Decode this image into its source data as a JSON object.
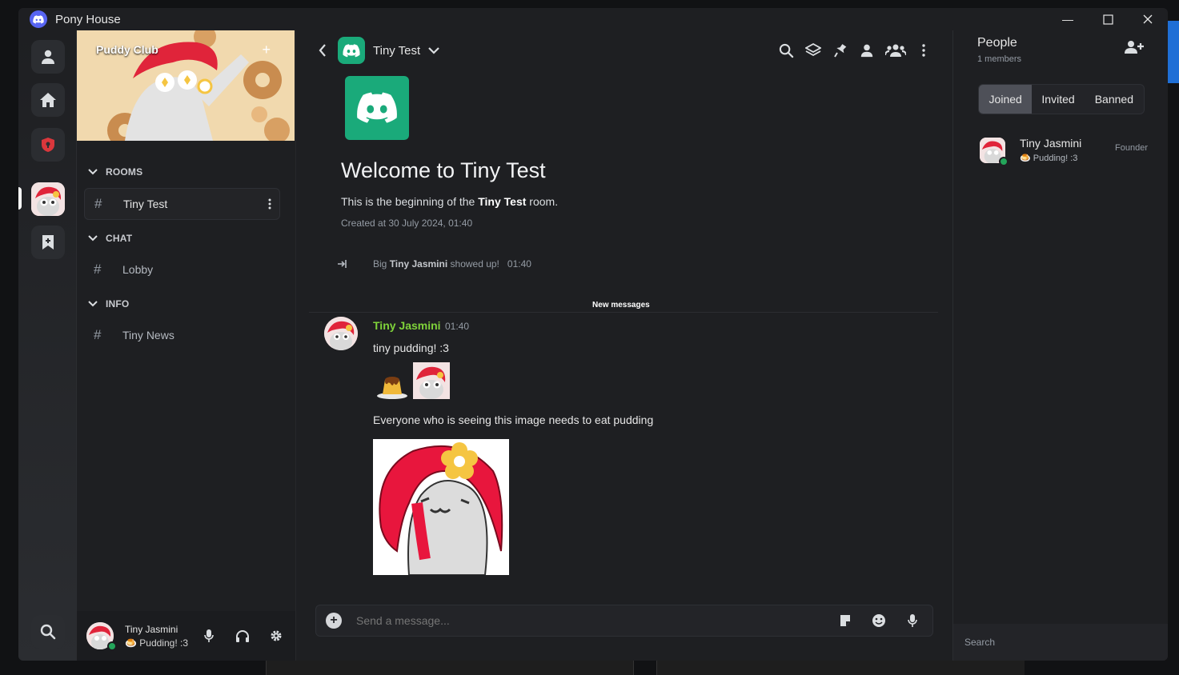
{
  "window": {
    "title": "Pony House"
  },
  "rail": {
    "items": [
      "profile-icon",
      "home-icon",
      "shield-icon",
      "puddy-club-avatar",
      "bookmark-icon"
    ],
    "search_icon": "search-icon"
  },
  "server": {
    "name": "Puddy Club",
    "add_icon": "+"
  },
  "categories": [
    {
      "label": "ROOMS",
      "rooms": [
        {
          "label": "Tiny Test",
          "active": true
        }
      ]
    },
    {
      "label": "CHAT",
      "rooms": [
        {
          "label": "Lobby"
        }
      ]
    },
    {
      "label": "INFO",
      "rooms": [
        {
          "label": "Tiny News"
        }
      ]
    }
  ],
  "current_user": {
    "name": "Tiny Jasmini",
    "status": "🍮 Pudding! :3"
  },
  "chat": {
    "room_title": "Tiny Test",
    "welcome_title": "Welcome to Tiny Test",
    "welcome_prefix": "This is the beginning of the",
    "welcome_room": "Tiny Test",
    "welcome_suffix": "room.",
    "created": "Created at 30 July 2024, 01:40",
    "join_event": {
      "prefix": "Big",
      "name": "Tiny Jasmini",
      "suffix": "showed up!",
      "time": "01:40"
    },
    "new_messages_label": "New messages",
    "message": {
      "author": "Tiny Jasmini",
      "time": "01:40",
      "line1": "tiny pudding! :3",
      "line2": "Everyone who is seeing this image needs to eat pudding"
    },
    "composer_placeholder": "Send a message..."
  },
  "people": {
    "title": "People",
    "count": "1 members",
    "tabs": [
      "Joined",
      "Invited",
      "Banned"
    ],
    "active_tab": "Joined",
    "members": [
      {
        "name": "Tiny Jasmini",
        "status": "🍮 Pudding! :3",
        "role": "Founder"
      }
    ],
    "search_placeholder": "Search"
  },
  "colors": {
    "accent_room": "#1aaa7a",
    "author": "#7fd33a",
    "online": "#23a55a"
  }
}
